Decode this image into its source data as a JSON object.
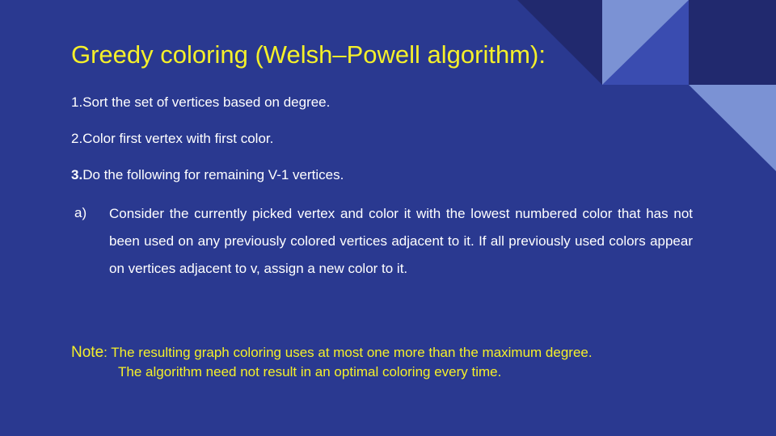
{
  "slide": {
    "title": "Greedy coloring (Welsh–Powell algorithm):",
    "steps": [
      {
        "number": "",
        "text": "1.Sort the set of vertices based on degree."
      },
      {
        "number": "",
        "text": "2.Color first vertex with first color."
      },
      {
        "number": "3.",
        "text": "Do the following for remaining V-1 vertices."
      }
    ],
    "substep": {
      "marker": "a)",
      "text": "Consider the currently picked vertex and color it with the lowest numbered color that has not been used on any previously colored vertices adjacent to it. If all previously used colors appear on vertices adjacent to v, assign a new color to it."
    },
    "note": {
      "label": "Note",
      "line1": ": The resulting graph coloring uses at most one more than the maximum degree.",
      "line2": "The algorithm need not result in an optimal coloring every time."
    }
  },
  "colors": {
    "background": "#2a3990",
    "title": "#f5f02a",
    "body_text": "#ffffff",
    "note_text": "#f5f02a",
    "deco_dark": "#21296e",
    "deco_light": "#7d93d6",
    "deco_mid": "#3a4cb0"
  }
}
